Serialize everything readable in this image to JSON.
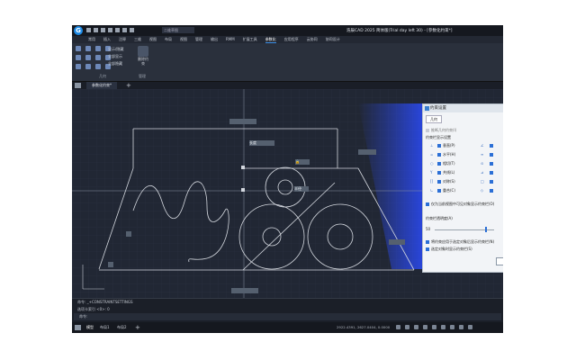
{
  "window": {
    "title": "浩辰CAD 2025 简体版(Trial day left 30) - [参数化约束*]",
    "logo_letter": "G",
    "workspace": "二维草图"
  },
  "menu": [
    "常用",
    "插入",
    "注释",
    "三维",
    "视图",
    "布局",
    "视图",
    "管理",
    "输出",
    "RMM",
    "扩展工具",
    "参数化",
    "应用程序",
    "云协同",
    "协同设计"
  ],
  "menu_active_index": 11,
  "ribbon": {
    "toggles": [
      "显示/隐藏",
      "全部显示",
      "全部隐藏"
    ],
    "delete_constraint": "删除约束",
    "group_geometric": "几何",
    "group_manage": "管理"
  },
  "doc_tab": "参数化约束*",
  "canvas_tags": {
    "lock_tag": "🔒",
    "circle_tag": "半径",
    "top_line_tag": "长度"
  },
  "dialog": {
    "title": "约束设置",
    "tab": "几何",
    "infer": "推断几何约束(I)",
    "group_label": "约束栏显示设置",
    "left_items": [
      "垂直(P)",
      "水平(H)",
      "相切(T)",
      "共线(L)",
      "对称(S)",
      "重合(C)"
    ],
    "left_symbols": [
      "⊥",
      "=",
      "○",
      "Y",
      "[]",
      "∟"
    ],
    "right_symbols": [
      "∠",
      "≡",
      "⊙",
      "⊿",
      "□",
      "◇"
    ],
    "only_visible": "仅为当前视图中可见对象显示约束栏(O)",
    "transparency_label": "约束栏透明度(A)",
    "transparency_value": "50",
    "show_after_apply": "将约束应用于选定对象后显示约束栏(N)",
    "show_when_selected": "选定对象时显示约束栏(S)"
  },
  "command": {
    "line1": "命令: _+CONSTRAINTSETTINGS",
    "line2": "选项卡索引 <0>: 0",
    "prompt": "命令:"
  },
  "status": {
    "model_tab": "模型",
    "layout1": "布局1",
    "layout2": "布局2",
    "coords": "2922.4391, 2627.0404, 0.0000"
  }
}
